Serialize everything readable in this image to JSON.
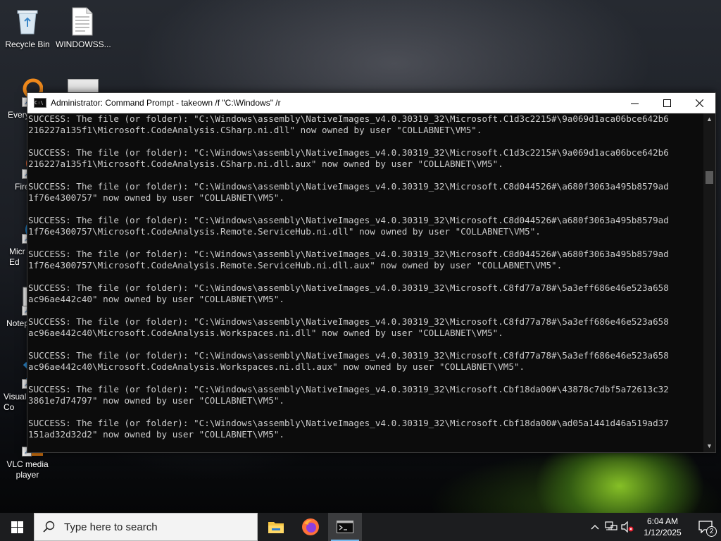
{
  "desktop": {
    "icons": [
      {
        "label": "Recycle Bin"
      },
      {
        "label": "WINDOWSS..."
      },
      {
        "label": "Every"
      },
      {
        "label": "Fire"
      },
      {
        "label": "Micr\nEd"
      },
      {
        "label": "Notep"
      },
      {
        "label": "Visual\nCo"
      },
      {
        "label": "VLC media\nplayer"
      }
    ]
  },
  "window": {
    "title": "Administrator: Command Prompt - takeown  /f \"C:\\Windows\" /r",
    "minimize_glyph": "—",
    "maximize_glyph": "☐",
    "close_glyph": "✕",
    "console_lines": [
      "SUCCESS: The file (or folder): \"C:\\Windows\\assembly\\NativeImages_v4.0.30319_32\\Microsoft.C1d3c2215#\\9a069d1aca06bce642b6",
      "216227a135f1\\Microsoft.CodeAnalysis.CSharp.ni.dll\" now owned by user \"COLLABNET\\VM5\".",
      "",
      "SUCCESS: The file (or folder): \"C:\\Windows\\assembly\\NativeImages_v4.0.30319_32\\Microsoft.C1d3c2215#\\9a069d1aca06bce642b6",
      "216227a135f1\\Microsoft.CodeAnalysis.CSharp.ni.dll.aux\" now owned by user \"COLLABNET\\VM5\".",
      "",
      "SUCCESS: The file (or folder): \"C:\\Windows\\assembly\\NativeImages_v4.0.30319_32\\Microsoft.C8d044526#\\a680f3063a495b8579ad",
      "1f76e4300757\" now owned by user \"COLLABNET\\VM5\".",
      "",
      "SUCCESS: The file (or folder): \"C:\\Windows\\assembly\\NativeImages_v4.0.30319_32\\Microsoft.C8d044526#\\a680f3063a495b8579ad",
      "1f76e4300757\\Microsoft.CodeAnalysis.Remote.ServiceHub.ni.dll\" now owned by user \"COLLABNET\\VM5\".",
      "",
      "SUCCESS: The file (or folder): \"C:\\Windows\\assembly\\NativeImages_v4.0.30319_32\\Microsoft.C8d044526#\\a680f3063a495b8579ad",
      "1f76e4300757\\Microsoft.CodeAnalysis.Remote.ServiceHub.ni.dll.aux\" now owned by user \"COLLABNET\\VM5\".",
      "",
      "SUCCESS: The file (or folder): \"C:\\Windows\\assembly\\NativeImages_v4.0.30319_32\\Microsoft.C8fd77a78#\\5a3eff686e46e523a658",
      "ac96ae442c40\" now owned by user \"COLLABNET\\VM5\".",
      "",
      "SUCCESS: The file (or folder): \"C:\\Windows\\assembly\\NativeImages_v4.0.30319_32\\Microsoft.C8fd77a78#\\5a3eff686e46e523a658",
      "ac96ae442c40\\Microsoft.CodeAnalysis.Workspaces.ni.dll\" now owned by user \"COLLABNET\\VM5\".",
      "",
      "SUCCESS: The file (or folder): \"C:\\Windows\\assembly\\NativeImages_v4.0.30319_32\\Microsoft.C8fd77a78#\\5a3eff686e46e523a658",
      "ac96ae442c40\\Microsoft.CodeAnalysis.Workspaces.ni.dll.aux\" now owned by user \"COLLABNET\\VM5\".",
      "",
      "SUCCESS: The file (or folder): \"C:\\Windows\\assembly\\NativeImages_v4.0.30319_32\\Microsoft.Cbf18da00#\\43878c7dbf5a72613c32",
      "3861e7d74797\" now owned by user \"COLLABNET\\VM5\".",
      "",
      "SUCCESS: The file (or folder): \"C:\\Windows\\assembly\\NativeImages_v4.0.30319_32\\Microsoft.Cbf18da00#\\ad05a1441d46a519ad37",
      "151ad32d32d2\" now owned by user \"COLLABNET\\VM5\"."
    ],
    "console_text_color": "#cccccc",
    "console_bg_color": "#0c0c0c"
  },
  "taskbar": {
    "search_placeholder": "Type here to search",
    "apps": [
      {
        "name": "File Explorer",
        "icon": "folder-icon"
      },
      {
        "name": "Firefox",
        "icon": "firefox-icon"
      },
      {
        "name": "Command Prompt",
        "icon": "cmd-icon",
        "active": true
      }
    ],
    "clock_time": "6:04 AM",
    "clock_date": "1/12/2025",
    "notification_count": "2",
    "accent_color": "#76b9ed"
  }
}
